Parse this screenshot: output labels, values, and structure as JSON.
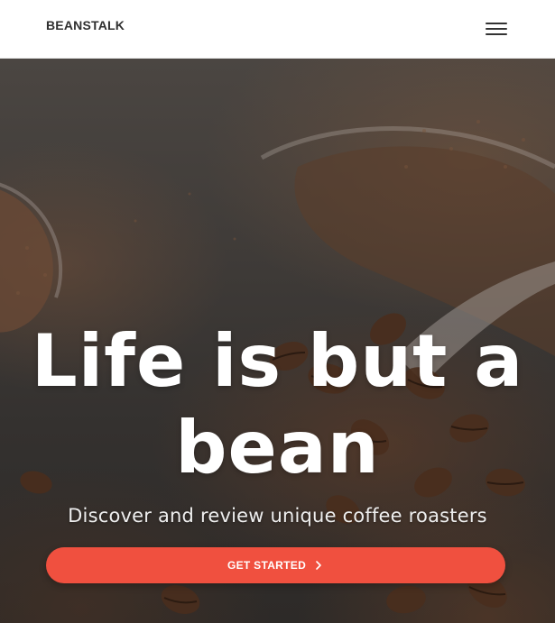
{
  "header": {
    "brand": "BEANSTALK",
    "menu_icon": "hamburger-menu-icon"
  },
  "hero": {
    "headline": "Life is but a bean",
    "subheadline": "Discover and review unique coffee roasters",
    "cta_label": "GET STARTED",
    "cta_icon": "chevron-right-icon",
    "background_image": "coffee beans on spoons"
  },
  "colors": {
    "accent": "#f0503f",
    "brand_text": "#2f2f2f",
    "header_bg": "#ffffff",
    "hero_overlay": "#3a3633"
  }
}
